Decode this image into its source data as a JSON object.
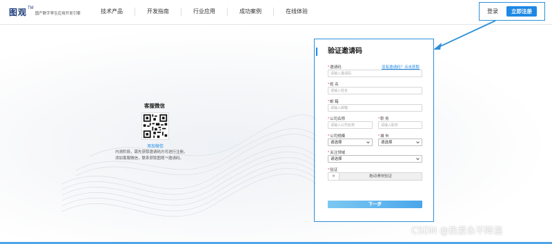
{
  "header": {
    "logo": "图观",
    "logo_tm": "TM",
    "logo_sub": "国产数字孪生应用开发引擎",
    "nav": [
      "技术产品",
      "开发指南",
      "行业应用",
      "成功案例",
      "在线体验"
    ],
    "login": "登录",
    "register": "立即注册"
  },
  "qr_panel": {
    "title": "客服微信",
    "caption": "添加微信",
    "desc_line1": "内测阶段，需先获取邀请码方可进行注册。",
    "desc_line2": "添加客服微信，联系获取图观™邀请码。"
  },
  "form": {
    "title": "验证邀请码",
    "help_link": "没有邀请码？点击获取",
    "invite_code": {
      "label": "邀请码",
      "placeholder": "请输入邀请码"
    },
    "name": {
      "label": "姓 名",
      "placeholder": "请输入姓名"
    },
    "email": {
      "label": "邮 箱",
      "placeholder": "请输入邮箱"
    },
    "company": {
      "label": "公司名称",
      "placeholder": "请输入公司名称"
    },
    "position": {
      "label": "职 务",
      "placeholder": "请输入职务"
    },
    "company_size": {
      "label": "公司规模",
      "value": "请选择"
    },
    "city": {
      "label": "城 市",
      "value": "请选择"
    },
    "focus_area": {
      "label": "关注领域",
      "value": "请选择"
    },
    "verify": {
      "label": "验证",
      "handle": "»",
      "text": "拖动滑块验证"
    },
    "submit": "下一步"
  },
  "watermark": "CSDN @热爱永不降温",
  "colors": {
    "accent": "#1e88e5",
    "highlight_border": "#2b8fd9",
    "required": "#e53935"
  }
}
